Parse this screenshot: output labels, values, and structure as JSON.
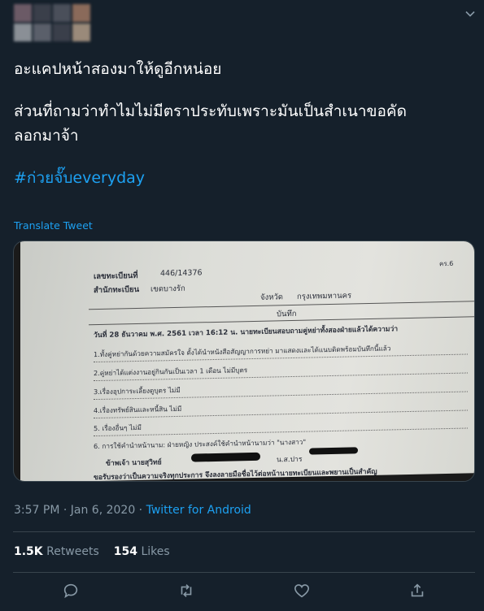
{
  "tweet": {
    "line1": "อะแคปหน้าสองมาให้ดูอีกหน่อย",
    "line2": "ส่วนที่ถามว่าทำไมไม่มีตราประทับเพราะมันเป็นสำเนาขอคัด",
    "line3": "ลอกมาจ้า",
    "hashtag": "#ก่วยจั๊บeveryday",
    "translate_label": "Translate Tweet"
  },
  "media_document": {
    "registration_no_label": "เลขทะเบียนที่",
    "registration_no": "446/14376",
    "office_label": "สำนักทะเบียน",
    "office": "เขตบางรัก",
    "province_label": "จังหวัด",
    "province": "กรุงเทพมหานคร",
    "form_code": "คร.6",
    "record_heading": "บันทึก",
    "line_date": "วันที่ 28 ธันวาคม พ.ศ. 2561 เวลา 16:12 น. นายทะเบียนสอบถามคู่หย่าทั้งสองฝ่ายแล้วได้ความว่า",
    "item1": "1.ทั้งคู่หย่ากันด้วยความสมัครใจ ตั้งได้นำหนังสือสัญญาการหย่า มาแสดงและได้แนบติดพร้อมบันทึกนี้แล้ว",
    "item2": "2.คู่หย่าได้แต่งงานอยู่กินกันเป็นเวลา 1 เดือน ไม่มีบุตร",
    "item3": "3.เรื่องอุปการะเลี้ยงดูบุตร ไม่มี",
    "item4": "4.เรื่องทรัพย์สินและหนี้สิน ไม่มี",
    "item5": "5. เรื่องอื่นๆ ไม่มี",
    "item6": "6. การใช้คำนำหน้านาม: ฝ่ายหญิง ประสงค์ใช้คำนำหน้านามว่า \"นางสาว\"",
    "signer_line": "ข้าพเจ้า นายสุวิทย์",
    "signer_line2": "น.ส.ปาร",
    "certify_line": "ขอรับรองว่าเป็นความจริงทุกประการ จึงลงลายมือชื่อไว้ต่อหน้านายทะเบียนและพยานเป็นสำคัญ"
  },
  "meta": {
    "time": "3:57 PM · Jan 6, 2020 · ",
    "source": "Twitter for Android"
  },
  "stats": {
    "retweets_count": "1.5K",
    "retweets_label": "Retweets",
    "likes_count": "154",
    "likes_label": "Likes"
  },
  "icons": {
    "caret": "chevron-down-icon",
    "reply": "reply-icon",
    "retweet": "retweet-icon",
    "like": "heart-icon",
    "share": "share-icon"
  },
  "colors": {
    "background": "#15202b",
    "accent": "#1da1f2",
    "muted": "#8899a6",
    "divider": "#38444d"
  }
}
